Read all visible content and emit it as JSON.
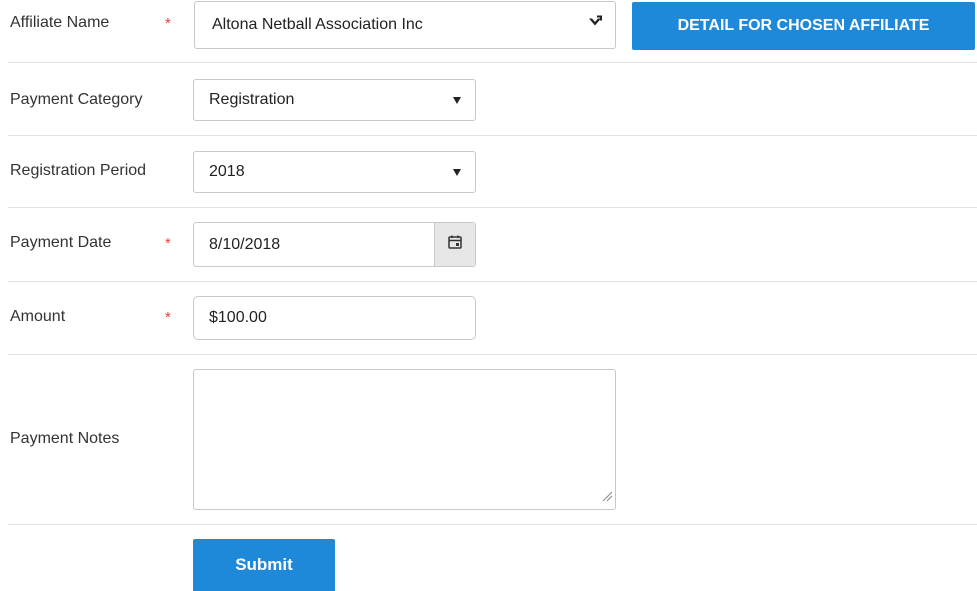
{
  "form": {
    "affiliate_name": {
      "label": "Affiliate Name",
      "required_mark": "*",
      "value": "Altona Netball Association Inc",
      "icon": "chevron-down-icon"
    },
    "detail_button": "DETAIL FOR CHOSEN AFFILIATE",
    "payment_category": {
      "label": "Payment Category",
      "value": "Registration",
      "icon": "caret-down-icon"
    },
    "registration_period": {
      "label": "Registration Period",
      "value": "2018",
      "icon": "caret-down-icon"
    },
    "payment_date": {
      "label": "Payment Date",
      "required_mark": "*",
      "value": "8/10/2018",
      "icon": "calendar-icon"
    },
    "amount": {
      "label": "Amount",
      "required_mark": "*",
      "value": "$100.00"
    },
    "payment_notes": {
      "label": "Payment Notes",
      "value": ""
    },
    "submit_button": "Submit"
  },
  "colors": {
    "primary": "#1e88d9",
    "required": "#e8413c",
    "divider": "#e3e3e3",
    "border": "#c8c8c8"
  }
}
